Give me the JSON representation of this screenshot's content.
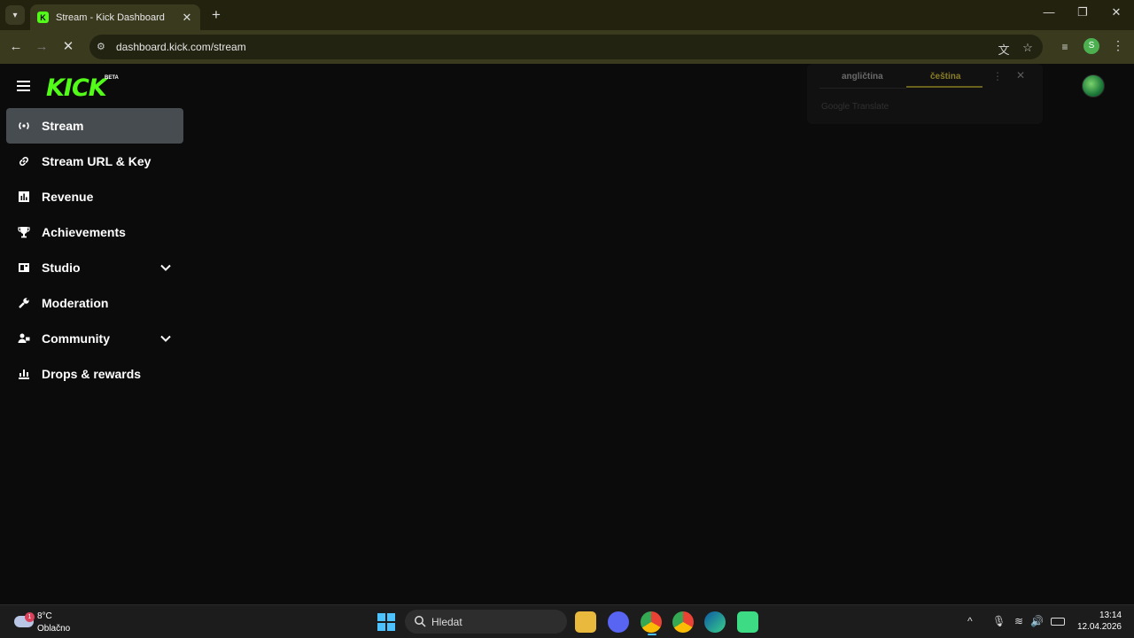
{
  "browser": {
    "tab_title": "Stream - Kick Dashboard",
    "favicon": "kick-favicon",
    "url": "dashboard.kick.com/stream"
  },
  "logo": {
    "text": "KICK",
    "badge": "BETA",
    "color": "#53fc18"
  },
  "sidebar": {
    "items": [
      {
        "label": "Stream",
        "icon": "broadcast-icon",
        "active": true
      },
      {
        "label": "Stream URL & Key",
        "icon": "link-icon"
      },
      {
        "label": "Revenue",
        "icon": "chart-icon"
      },
      {
        "label": "Achievements",
        "icon": "trophy-icon"
      },
      {
        "label": "Studio",
        "icon": "studio-icon",
        "expandable": true
      },
      {
        "label": "Moderation",
        "icon": "wrench-icon"
      },
      {
        "label": "Community",
        "icon": "community-icon",
        "expandable": true
      },
      {
        "label": "Drops & rewards",
        "icon": "drops-icon"
      }
    ]
  },
  "translate": {
    "lang_source": "angličtina",
    "lang_target": "čeština",
    "brand": "Google Translate"
  },
  "taskbar": {
    "weather_temp": "8°C",
    "weather_cond": "Oblačno",
    "weather_badge": "1",
    "search_placeholder": "Hledat",
    "time": "13:14",
    "date": "12.04.2026"
  },
  "profile_initial": "S"
}
